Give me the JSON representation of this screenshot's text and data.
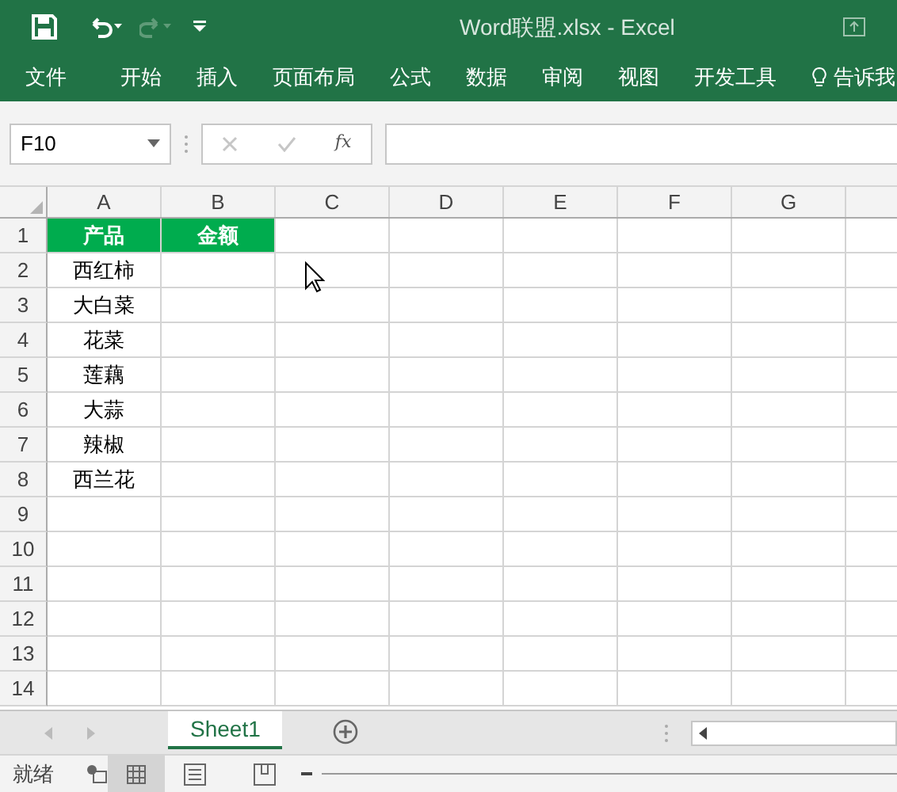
{
  "window": {
    "title": "Word联盟.xlsx - Excel"
  },
  "ribbon_tabs": [
    "文件",
    "开始",
    "插入",
    "页面布局",
    "公式",
    "数据",
    "审阅",
    "视图",
    "开发工具"
  ],
  "tell_me": "告诉我",
  "name_box": "F10",
  "formula_fx": "fx",
  "columns": [
    "A",
    "B",
    "C",
    "D",
    "E",
    "F",
    "G"
  ],
  "rows": [
    {
      "number": "1",
      "kind": "header",
      "cells": [
        "产品",
        "金额"
      ]
    },
    {
      "number": "2",
      "kind": "data",
      "cells": [
        "西红柿"
      ]
    },
    {
      "number": "3",
      "kind": "data",
      "cells": [
        "大白菜"
      ]
    },
    {
      "number": "4",
      "kind": "data",
      "cells": [
        "花菜"
      ]
    },
    {
      "number": "5",
      "kind": "data",
      "cells": [
        "莲藕"
      ]
    },
    {
      "number": "6",
      "kind": "data",
      "cells": [
        "大蒜"
      ]
    },
    {
      "number": "7",
      "kind": "data",
      "cells": [
        "辣椒"
      ]
    },
    {
      "number": "8",
      "kind": "data",
      "cells": [
        "西兰花"
      ]
    },
    {
      "number": "9",
      "kind": "data",
      "cells": []
    },
    {
      "number": "10",
      "kind": "data",
      "cells": []
    },
    {
      "number": "11",
      "kind": "data",
      "cells": []
    },
    {
      "number": "12",
      "kind": "data",
      "cells": []
    },
    {
      "number": "13",
      "kind": "data",
      "cells": []
    },
    {
      "number": "14",
      "kind": "data",
      "cells": []
    }
  ],
  "sheet_tabs": [
    {
      "label": "Sheet1",
      "selected": true
    }
  ],
  "status_bar": {
    "text": "就绪"
  }
}
